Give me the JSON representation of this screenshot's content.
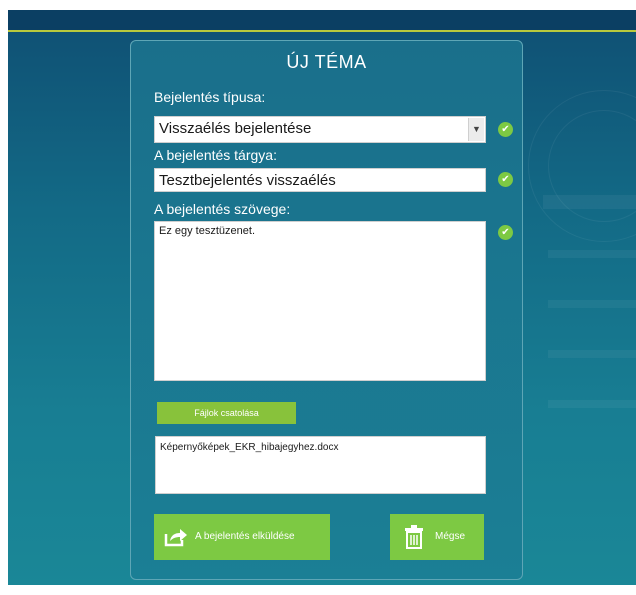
{
  "form": {
    "title": "ÚJ TÉMA",
    "type_label": "Bejelentés típusa:",
    "type_value": "Visszaélés bejelentése",
    "subject_label": "A bejelentés tárgya:",
    "subject_value": "Tesztbejelentés visszaélés",
    "body_label": "A bejelentés szövege:",
    "body_value": "Ez egy tesztüzenet.",
    "attach_button": "Fájlok csatolása",
    "attached_file": "Képernyőképek_EKR_hibajegyhez.docx",
    "submit_button": "A bejelentés elküldése",
    "cancel_button": "Mégse"
  },
  "icons": {
    "valid": "check-circle-icon",
    "dropdown": "chevron-down-icon",
    "submit": "share-arrow-icon",
    "cancel": "trash-icon"
  },
  "colors": {
    "accent_green": "#7dc943",
    "background_teal": "#187e93",
    "top_line": "#b9c93c"
  }
}
